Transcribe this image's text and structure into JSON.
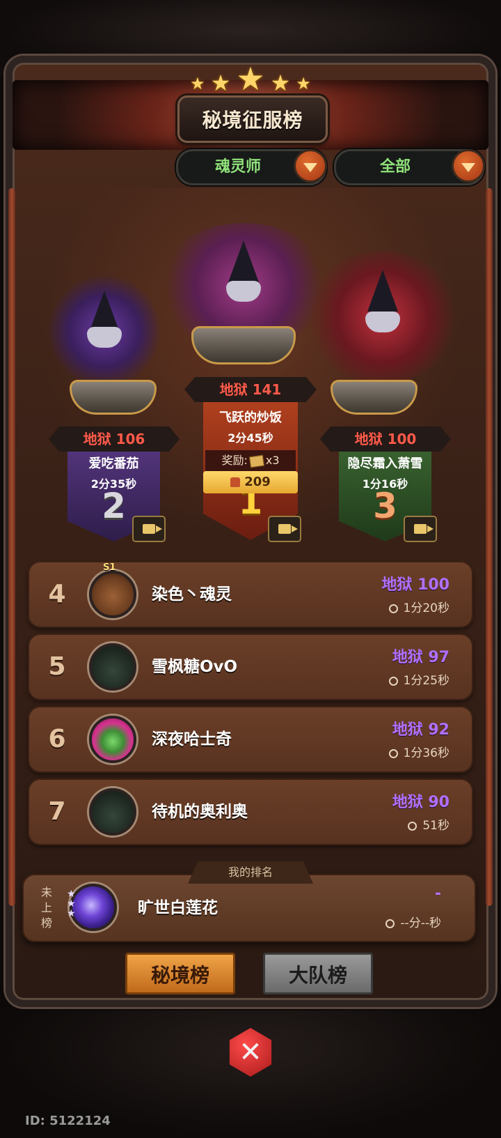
{
  "title": "秘境征服榜",
  "filters": {
    "class_value": "魂灵师",
    "scope_value": "全部"
  },
  "podium": [
    {
      "rank": "2",
      "level": "地狱 106",
      "name": "爱吃番茄",
      "time": "2分35秒"
    },
    {
      "rank": "1",
      "level": "地狱 141",
      "name": "飞跃的炒饭",
      "time": "2分45秒",
      "reward_label": "奖励:",
      "reward_qty": "x3",
      "likes": "209"
    },
    {
      "rank": "3",
      "level": "地狱 100",
      "name": "隐尽霜入萧雪",
      "time": "1分16秒"
    }
  ],
  "list": [
    {
      "rank": "4",
      "badge": "S1",
      "name": "染色丶魂灵",
      "level": "地狱 100",
      "time": "1分20秒"
    },
    {
      "rank": "5",
      "name": "雪枫糖OvO",
      "level": "地狱 97",
      "time": "1分25秒"
    },
    {
      "rank": "6",
      "name": "深夜哈士奇",
      "level": "地狱 92",
      "time": "1分36秒"
    },
    {
      "rank": "7",
      "name": "待机的奥利奥",
      "level": "地狱 90",
      "time": "51秒"
    }
  ],
  "my_rank": {
    "tab_label": "我的排名",
    "status": "未上榜",
    "name": "旷世白莲花",
    "level": "-",
    "time": "--分--秒"
  },
  "tabs": {
    "secret": "秘境榜",
    "team": "大队榜"
  },
  "close_label": "✕",
  "id_text": "ID: 5122124",
  "colors": {
    "accent_orange": "#e06b2e",
    "level_red": "#ff5a4a",
    "level_purple": "#b070ff",
    "filter_green": "#8fe17a"
  },
  "icons": [
    "star-icon",
    "chevron-down-icon",
    "video-icon",
    "thumb-up-icon",
    "clock-icon",
    "close-icon"
  ]
}
